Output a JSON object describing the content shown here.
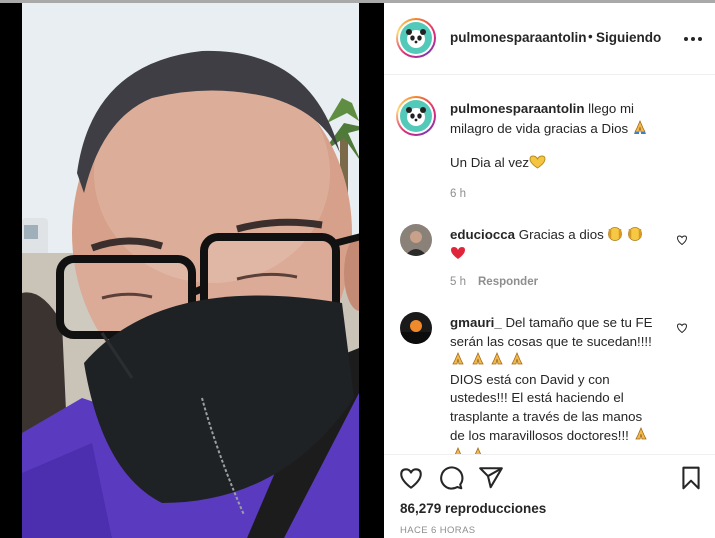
{
  "post": {
    "username": "pulmonesparaantolin",
    "separator": "•",
    "follow_status": "Siguiendo",
    "more_icon": "more-options-icon"
  },
  "caption": {
    "username": "pulmonesparaantolin",
    "text_line1": "llego mi",
    "text_line2": "milagro de vida gracias a Dios",
    "text_line3": "Un Dia al vez",
    "time": "6 h"
  },
  "comments": [
    {
      "username": "educiocca",
      "text": "Gracias a dios",
      "time": "5 h",
      "reply_label": "Responder"
    },
    {
      "username": "gmauri_",
      "lines": [
        "Del tamaño que se tu FE",
        "serán las cosas que te sucedan!!!!",
        "DIOS está con David y con",
        "ustedes!!! El está haciendo el",
        "trasplante a través de las manos",
        "de los maravillosos doctores!!!"
      ]
    }
  ],
  "footer": {
    "views": "86,279 reproducciones",
    "time_ago": "HACE 6 HORAS"
  },
  "colors": {
    "like_heart": "#ed4956",
    "secondary_text": "#8e8e8e",
    "border": "#efefef"
  }
}
